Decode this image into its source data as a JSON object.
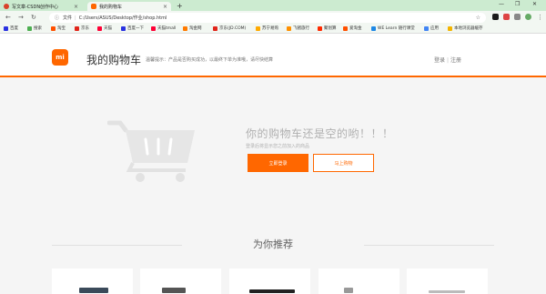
{
  "browser": {
    "tabs": [
      {
        "label": "写文章-CSDN创作中心",
        "active": false
      },
      {
        "label": "我的购物车",
        "active": true
      }
    ],
    "new_tab": "+",
    "window_controls": {
      "minimize": "—",
      "restore": "❐",
      "close": "✕"
    },
    "nav": {
      "back": "←",
      "forward": "→",
      "reload": "↻"
    },
    "address": {
      "info_label": "文件",
      "url": "C:/Users/ASUS/Desktop/作业/shop.html",
      "star": "☆"
    },
    "bookmarks": [
      {
        "label": "百度",
        "color": "#2932e1"
      },
      {
        "label": "搜索",
        "color": "#4caf50"
      },
      {
        "label": "淘宝",
        "color": "#ff5000"
      },
      {
        "label": "京东",
        "color": "#e1251b"
      },
      {
        "label": "天猫",
        "color": "#ff0036"
      },
      {
        "label": "百度一下",
        "color": "#2932e1"
      },
      {
        "label": "天猫tmall",
        "color": "#ff0036"
      },
      {
        "label": "淘金网",
        "color": "#ff7a00"
      },
      {
        "label": "京东(JD.COM)",
        "color": "#e1251b"
      },
      {
        "label": "苏宁易购",
        "color": "#ffaa00"
      },
      {
        "label": "飞猪旅行",
        "color": "#ff9000"
      },
      {
        "label": "聚划算",
        "color": "#ff2a00"
      },
      {
        "label": "爱淘金",
        "color": "#ff5000"
      },
      {
        "label": "WE Learn 随行课堂",
        "color": "#1e88e5"
      },
      {
        "label": "应用",
        "color": "#4285f4"
      },
      {
        "label": "本地浏览器缓存",
        "color": "#f4b400"
      }
    ]
  },
  "header": {
    "logo": "mi",
    "title": "我的购物车",
    "tip": "温馨提示：产品是否购买成功，以最终下单为准哦，请尽快结算",
    "login": "登录",
    "register": "注册",
    "separator": "|"
  },
  "empty_cart": {
    "title": "你的购物车还是空的哟！！！",
    "subtitle": "登录后将显示您之前加入的商品",
    "login_button": "立即登录",
    "shop_button": "马上购物"
  },
  "recommend": {
    "title": "为你推荐"
  },
  "colors": {
    "accent": "#ff6700",
    "tabbar": "#ccebd0"
  }
}
